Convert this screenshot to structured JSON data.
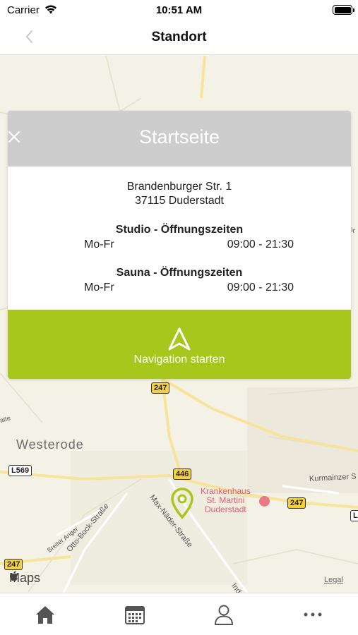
{
  "status": {
    "carrier": "Carrier",
    "time": "10:51 AM"
  },
  "header": {
    "title": "Standort"
  },
  "map": {
    "place_label": "Westerode",
    "roads": {
      "r247_top": "247",
      "r446": "446",
      "r247_right": "247",
      "r247_left": "247",
      "l569": "L569",
      "l_right": "L"
    },
    "streets": {
      "max_naeder": "Max-Näder-Straße",
      "otto_bock": "Otto-Bock-Straße",
      "breiter_anger": "Breiter Anger",
      "kurmainzer": "Kurmainzer S",
      "indu": "Indu",
      "atte": "atte",
      "edge_text": "ht"
    },
    "hospital": {
      "line1": "Krankenhaus",
      "line2": "St. Martini",
      "line3": "Duderstadt"
    },
    "maps_logo": "Maps",
    "legal": "Legal"
  },
  "popup": {
    "title": "Startseite",
    "address_line1": "Brandenburger Str. 1",
    "address_line2": "37115 Duderstadt",
    "studio_title": "Studio - Öffnungszeiten",
    "studio_days": "Mo-Fr",
    "studio_hours": "09:00 - 21:30",
    "sauna_title": "Sauna - Öffnungszeiten",
    "sauna_days": "Mo-Fr",
    "sauna_hours": "09:00 - 21:30",
    "nav_button_label": "Navigation starten"
  },
  "colors": {
    "accent": "#a8c71c",
    "popup_header": "#cdcdcd"
  },
  "tabs": [
    "home-icon",
    "calendar-icon",
    "profile-icon",
    "more-icon"
  ]
}
